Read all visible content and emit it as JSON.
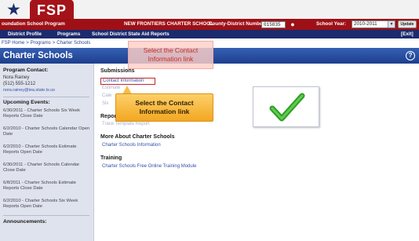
{
  "header": {
    "logo_text": "FSP",
    "program_label": "oundation School Program",
    "school_name": "NEW FRONTIERS CHARTER SCHOOL",
    "district_label": "County-District Number:",
    "district_value": "015835",
    "year_label": "School Year:",
    "year_value": "2010-2011",
    "update_label": "Update"
  },
  "nav": {
    "items": [
      "District Profile",
      "Programs",
      "School District State Aid Reports"
    ],
    "exit_label": "[Exit]"
  },
  "breadcrumb": [
    "FSP Home",
    "Programs",
    "Charter Schools"
  ],
  "page": {
    "title": "Charter Schools",
    "help_glyph": "?"
  },
  "sidebar": {
    "contact_heading": "Program Contact:",
    "contact_name": "Nora Rainey",
    "contact_phone": "(512) 555-1212",
    "contact_email": "nora.rainey@tea.state.tx.us",
    "events_heading": "Upcoming Events:",
    "events": [
      "6/30/2011 - Charter Schools Six Week Reports Close Date",
      "6/2/2010 - Charter Schools Calendar Open Date",
      "6/2/2010 - Charter Schools Estimate Reports Open Date",
      "6/30/2011 - Charter Schools Calendar Close Date",
      "6/8/2011 - Charter Schools Estimate Reports Close Date",
      "6/2/2010 - Charter Schools Six Week Reports Open Date"
    ],
    "announcements_heading": "Announcements:"
  },
  "main": {
    "submissions_heading": "Submissions",
    "contact_link": "Contact Information",
    "faded_links": [
      "Estimate",
      "Cale",
      "Six"
    ],
    "reports_heading": "Repor",
    "reports_link": "Trace Template Report",
    "about_heading": "More About Charter Schools",
    "about_link": "Charter Schools Information",
    "training_heading": "Training",
    "training_link": "Charter Schools Free Online Training Module"
  },
  "overlays": {
    "top_instruction": "Select the Contact Information link",
    "callout_instruction": "Select the Contact Information link"
  },
  "colors": {
    "header_red": "#9e1016",
    "nav_blue": "#1c2b6d",
    "title_blue": "#2a4fa2",
    "callout_orange": "#f3a721",
    "check_green": "#2e9e24"
  }
}
